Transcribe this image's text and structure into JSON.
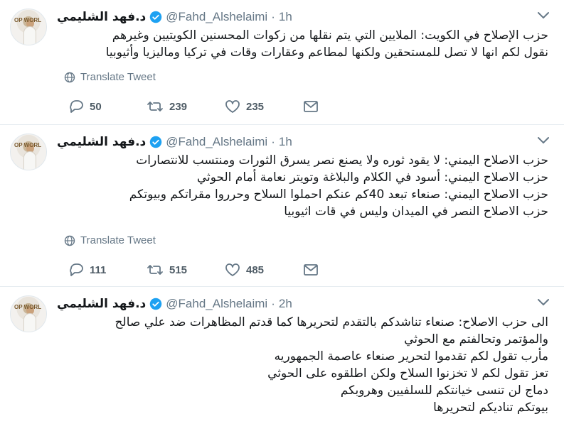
{
  "tweets": [
    {
      "name": "د.فهد الشليمي",
      "handle": "@Fahd_Alshelaimi",
      "separator": "·",
      "time": "1h",
      "lines": [
        "حزب الإصلاح في الكويت: الملايين التي يتم نقلها من زكوات المحسنين الكويتيين وغيرهم",
        "نقول لكم انها لا تصل للمستحقين ولكنها لمطاعم وعقارات وقات في تركيا وماليزيا وأثيوبيا"
      ],
      "translate_label": "Translate Tweet",
      "replies": "50",
      "retweets": "239",
      "likes": "235"
    },
    {
      "name": "د.فهد الشليمي",
      "handle": "@Fahd_Alshelaimi",
      "separator": "·",
      "time": "1h",
      "lines": [
        "حزب الاصلاح اليمني: لا يقود ثوره ولا يصنع نصر يسرق الثورات ومنتسب للانتصارات",
        "حزب الاصلاح اليمني: أسود في الكلام والبلاغة وتويتر نعامة أمام الحوثي",
        "حزب الاصلاح اليمني: صنعاء تبعد 40كم عنكم احملوا السلاح وحرروا مقراتكم وبيوتكم",
        "حزب الاصلاح النصر في الميدان وليس في قات اثيوبيا"
      ],
      "translate_label": "Translate Tweet",
      "replies": "111",
      "retweets": "515",
      "likes": "485"
    },
    {
      "name": "د.فهد الشليمي",
      "handle": "@Fahd_Alshelaimi",
      "separator": "·",
      "time": "2h",
      "lines": [
        "الى حزب الاصلاح: صنعاء تناشدكم بالتقدم لتحريرها كما قدتم المظاهرات ضد علي صالح",
        "والمؤتمر وتحالفتم مع الحوثي",
        "مأرب تقول لكم تقدموا لتحرير صنعاء عاصمة الجمهوريه",
        "تعز تقول لكم لا تخزنوا السلاح ولكن اطلقوه على الحوثي",
        "دماج لن تنسى خيانتكم للسلفيين وهروبكم",
        "بيوتكم تناديكم لتحريرها"
      ]
    }
  ],
  "avatar_text": "OP WORL",
  "colors": {
    "verified": "#1da1f2",
    "icon_gray": "#657786",
    "divider": "#e6ecf0"
  }
}
